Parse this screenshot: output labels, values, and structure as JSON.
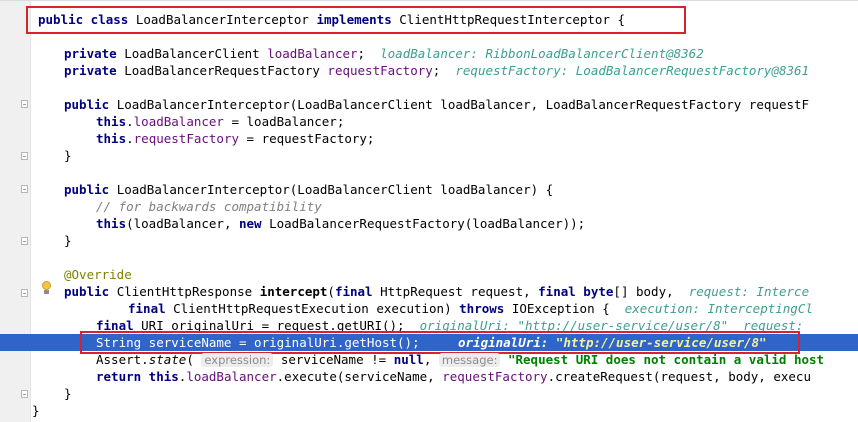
{
  "editor": {
    "lines": {
      "l1": [
        "public class ",
        "LoadBalancerInterceptor ",
        "implements ",
        "ClientHttpRequestInterceptor {"
      ],
      "l2": [
        "private ",
        "LoadBalancerClient ",
        "loadBalancer",
        ";",
        "loadBalancer: RibbonLoadBalancerClient@8362"
      ],
      "l3": [
        "private ",
        "LoadBalancerRequestFactory ",
        "requestFactory",
        ";",
        "requestFactory: LoadBalancerRequestFactory@8361"
      ],
      "l4": [
        "public ",
        "LoadBalancerInterceptor",
        "(LoadBalancerClient loadBalancer, LoadBalancerRequestFactory requestF"
      ],
      "l5": [
        "this",
        ".",
        "loadBalancer",
        " = loadBalancer;"
      ],
      "l6": [
        "this",
        ".",
        "requestFactory",
        " = requestFactory;"
      ],
      "l7": [
        "}"
      ],
      "l8": [
        "public ",
        "LoadBalancerInterceptor",
        "(LoadBalancerClient loadBalancer) {"
      ],
      "l9": [
        "// for backwards compatibility"
      ],
      "l10": [
        "this",
        "(loadBalancer, ",
        "new ",
        "LoadBalancerRequestFactory(loadBalancer));"
      ],
      "l11": [
        "}"
      ],
      "l12": [
        "@Override"
      ],
      "l13": [
        "public ",
        "ClientHttpResponse ",
        "intercept",
        "(",
        "final ",
        "HttpRequest request, ",
        "final byte",
        "[] body,",
        "request: Interce"
      ],
      "l14": [
        "final ",
        "ClientHttpRequestExecution execution) ",
        "throws ",
        "IOException {",
        "execution: InterceptingCl"
      ],
      "l15": [
        "final ",
        "URI originalUri = request.getURI();",
        "originalUri: \"http://user-service/user/8\"",
        "request: "
      ],
      "l16": [
        "String serviceName = originalUri.getHost();",
        "originalUri: ",
        "\"http://user-service/user/8\""
      ],
      "l17": [
        "Assert.",
        "state",
        "(",
        "expression:",
        " serviceName != ",
        "null",
        ",",
        "message:",
        " \"Request URI does not contain a valid host"
      ],
      "l18": [
        "return this",
        ".",
        "loadBalancer",
        ".execute(serviceName, ",
        "requestFactory",
        ".createRequest(request, body, execu"
      ],
      "l19": [
        "}"
      ],
      "l20": [
        "}"
      ]
    }
  }
}
